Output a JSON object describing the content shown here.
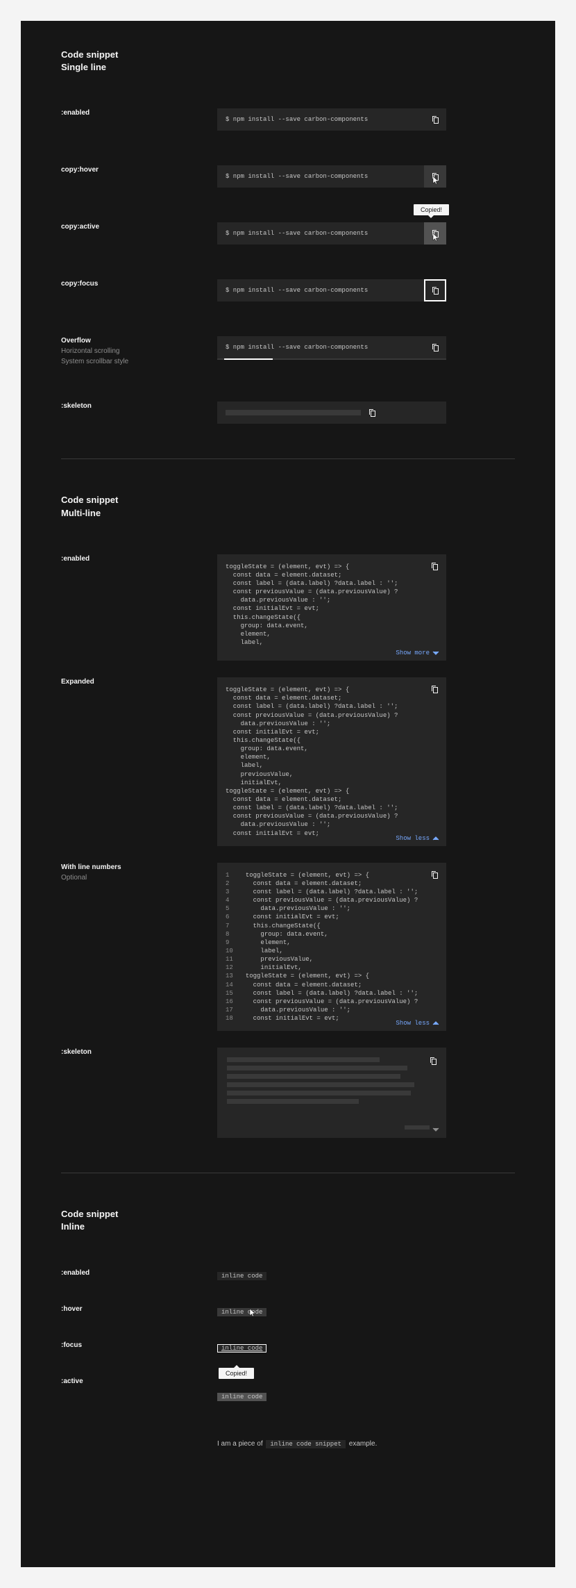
{
  "sections": {
    "single": {
      "title": "Code snippet",
      "subtitle": "Single line"
    },
    "multi": {
      "title": "Code snippet",
      "subtitle": "Multi-line"
    },
    "inline": {
      "title": "Code snippet",
      "subtitle": "Inline"
    }
  },
  "states": {
    "enabled": ":enabled",
    "copy_hover": "copy:hover",
    "copy_active": "copy:active",
    "copy_focus": "copy:focus",
    "overflow": "Overflow",
    "overflow_sub1": "Horizontal scrolling",
    "overflow_sub2": "System scrollbar style",
    "skeleton": ":skeleton",
    "expanded": "Expanded",
    "line_numbers": "With line numbers",
    "line_numbers_sub": "Optional",
    "hover": ":hover",
    "focus": ":focus",
    "active": ":active"
  },
  "single_code": "$ npm install --save carbon-components",
  "tooltip_copied": "Copied!",
  "multi_code_lines": [
    "toggleState = (element, evt) => {",
    "  const data = element.dataset;",
    "  const label = (data.label) ?data.label : '';",
    "  const previousValue = (data.previousValue) ?",
    "    data.previousValue : '';",
    "  const initialEvt = evt;",
    "  this.changeState({",
    "    group: data.event,",
    "    element,",
    "    label,"
  ],
  "multi_code_expanded_lines": [
    "toggleState = (element, evt) => {",
    "  const data = element.dataset;",
    "  const label = (data.label) ?data.label : '';",
    "  const previousValue = (data.previousValue) ?",
    "    data.previousValue : '';",
    "  const initialEvt = evt;",
    "  this.changeState({",
    "    group: data.event,",
    "    element,",
    "    label,",
    "    previousValue,",
    "    initialEvt,",
    "toggleState = (element, evt) => {",
    "  const data = element.dataset;",
    "  const label = (data.label) ?data.label : '';",
    "  const previousValue = (data.previousValue) ?",
    "    data.previousValue : '';",
    "  const initialEvt = evt;"
  ],
  "multi_code_ln_lines": [
    "toggleState = (element, evt) => {",
    "  const data = element.dataset;",
    "  const label = (data.label) ?data.label : '';",
    "  const previousValue = (data.previousValue) ?",
    "    data.previousValue : '';",
    "  const initialEvt = evt;",
    "  this.changeState({",
    "    group: data.event,",
    "    element,",
    "    label,",
    "    previousValue,",
    "    initialEvt,",
    "toggleState = (element, evt) => {",
    "  const data = element.dataset;",
    "  const label = (data.label) ?data.label : '';",
    "  const previousValue = (data.previousValue) ?",
    "    data.previousValue : '';",
    "  const initialEvt = evt;"
  ],
  "show_more": "Show more",
  "show_less": "Show less",
  "inline_code": "inline code",
  "inline_sentence_before": "I am a piece of ",
  "inline_sentence_code": "inline code snippet",
  "inline_sentence_after": " example.",
  "skeleton_multi_widths": [
    220,
    260,
    250,
    270,
    265,
    190
  ]
}
